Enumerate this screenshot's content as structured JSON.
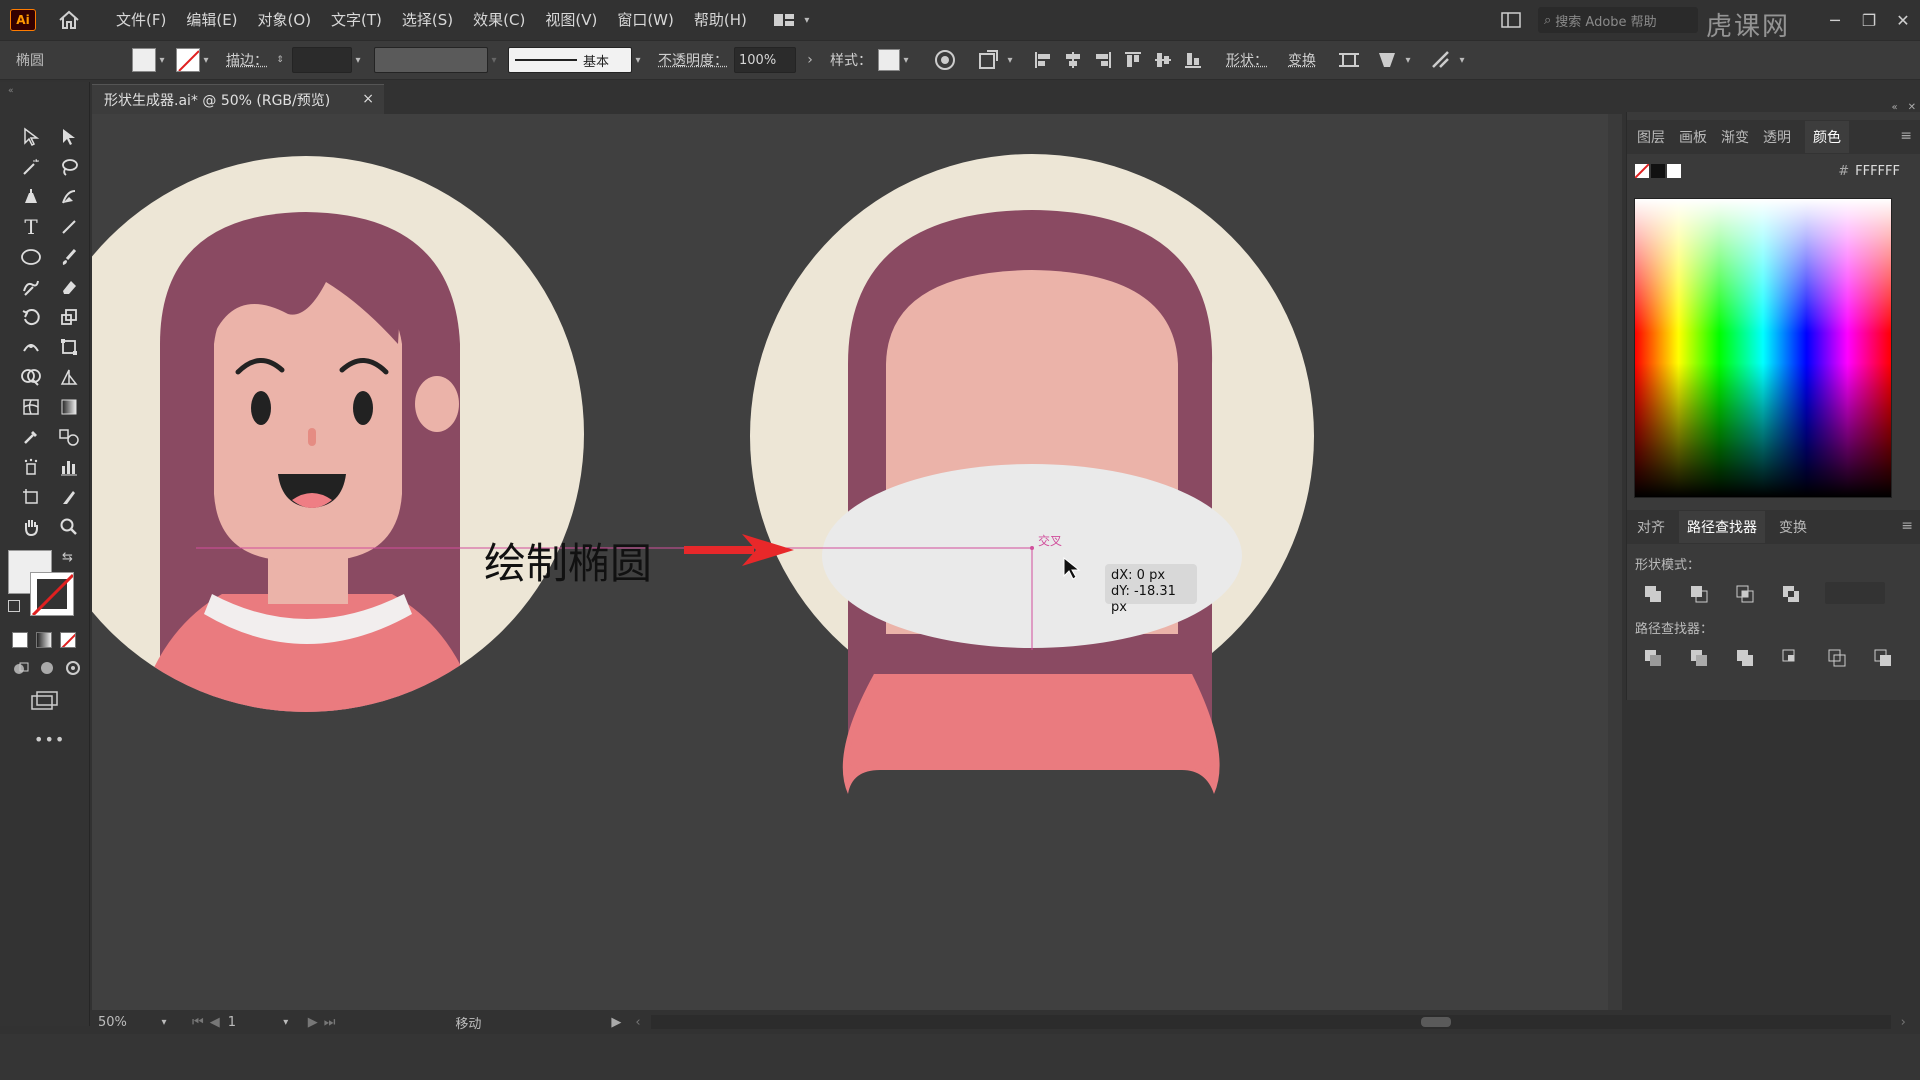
{
  "app": {
    "logo": "Ai"
  },
  "menu": [
    "文件(F)",
    "编辑(E)",
    "对象(O)",
    "文字(T)",
    "选择(S)",
    "效果(C)",
    "视图(V)",
    "窗口(W)",
    "帮助(H)"
  ],
  "search": {
    "placeholder": "搜索 Adobe 帮助"
  },
  "control_bar": {
    "selection_type": "椭圆",
    "stroke_label": "描边：",
    "stroke_style": "基本",
    "opacity_label": "不透明度：",
    "opacity_value": "100%",
    "style_label": "样式：",
    "shape_label": "形状：",
    "transform_label": "变换"
  },
  "document_tab": {
    "title": "形状生成器.ai* @ 50% (RGB/预览)",
    "close": "×"
  },
  "canvas": {
    "annotation": "绘制椭圆",
    "smart_guide_label": "交叉",
    "tooltip_dx": "dX: 0 px",
    "tooltip_dy": "dY: -18.31 px"
  },
  "right_panel": {
    "top_tabs": [
      "图层",
      "画板",
      "渐变",
      "透明",
      "颜色"
    ],
    "active_top_tab": "颜色",
    "hex_label": "#",
    "hex_value": "FFFFFF",
    "bottom_tabs": [
      "对齐",
      "路径查找器",
      "变换"
    ],
    "active_bottom_tab": "路径查找器",
    "shape_modes_label": "形状模式：",
    "pathfinders_label": "路径查找器："
  },
  "status_bar": {
    "zoom": "50%",
    "artboard": "1",
    "status": "移动"
  },
  "watermark": {
    "text": "虎课网"
  },
  "colors": {
    "bg_circle": "#ede6d6",
    "hair": "#8a4a62",
    "skin": "#ebb3a9",
    "shirt": "#ea7b7f",
    "ellipse": "#eaeaea",
    "arrow": "#e8282a",
    "guide": "#d14f9c"
  }
}
